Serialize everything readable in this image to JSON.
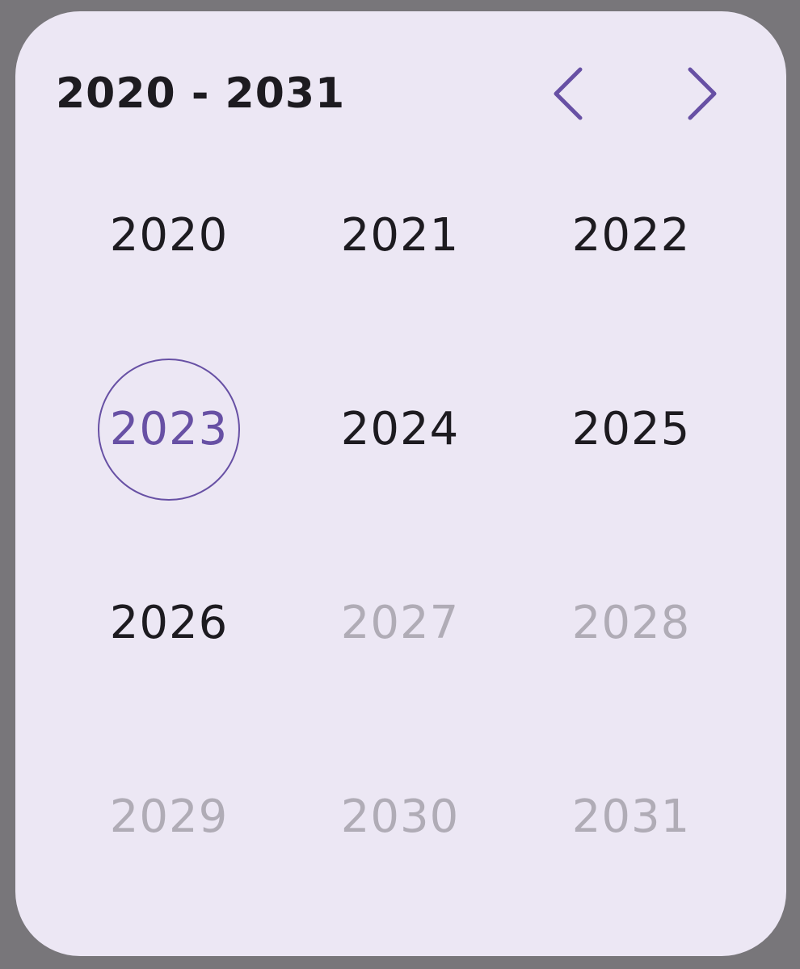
{
  "picker": {
    "range_title": "2020 - 2031",
    "prev_icon": "chevron-left-icon",
    "next_icon": "chevron-right-icon",
    "years": [
      {
        "label": "2020",
        "state": "enabled"
      },
      {
        "label": "2021",
        "state": "enabled"
      },
      {
        "label": "2022",
        "state": "enabled"
      },
      {
        "label": "2023",
        "state": "current"
      },
      {
        "label": "2024",
        "state": "enabled"
      },
      {
        "label": "2025",
        "state": "enabled"
      },
      {
        "label": "2026",
        "state": "enabled"
      },
      {
        "label": "2027",
        "state": "disabled"
      },
      {
        "label": "2028",
        "state": "disabled"
      },
      {
        "label": "2029",
        "state": "disabled"
      },
      {
        "label": "2030",
        "state": "disabled"
      },
      {
        "label": "2031",
        "state": "disabled"
      }
    ]
  },
  "colors": {
    "surface": "#ece7f4",
    "scrim": "#78767a",
    "primary": "#6750a4",
    "on_surface": "#1d1b20",
    "disabled": "#b0acb6"
  }
}
